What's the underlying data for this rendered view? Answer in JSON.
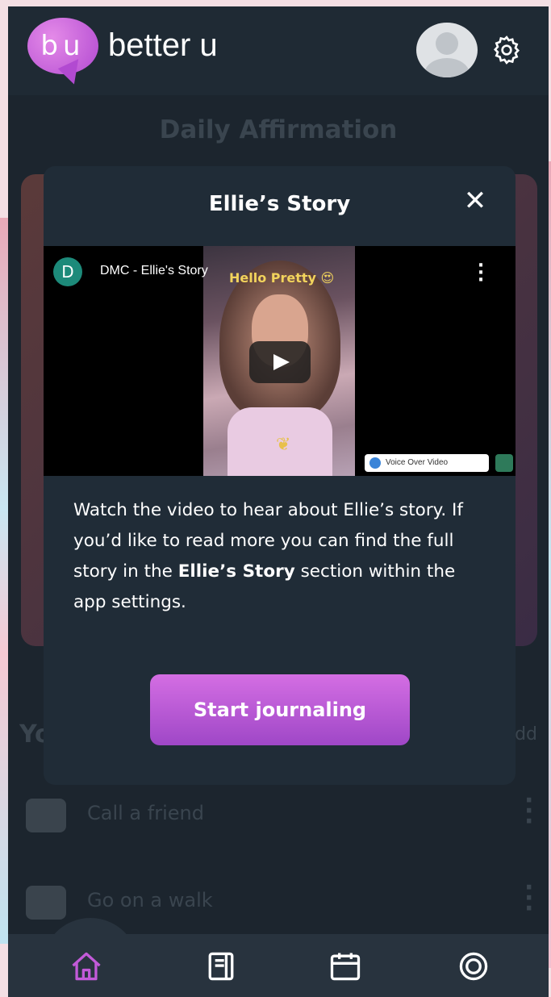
{
  "header": {
    "logo_text": "bu",
    "brand_name": "better u"
  },
  "background": {
    "page_title": "Daily Affirmation",
    "section_title": "Yo",
    "add_label": "Add",
    "todos": [
      {
        "label": "Call a friend"
      },
      {
        "label": "Go on a walk"
      }
    ]
  },
  "modal": {
    "title": "Ellie’s Story",
    "video": {
      "channel_initial": "D",
      "title": "DMC - Ellie's Story",
      "overlay_text": "Hello Pretty 😍",
      "voice_over_label": "Voice Over Video"
    },
    "description_part1": "Watch the video to hear about Ellie’s story. If you’d like to read more you can find the full story in the ",
    "description_bold": "Ellie’s Story",
    "description_part2": " section within the app settings.",
    "button_label": "Start journaling"
  },
  "nav": {
    "items": [
      {
        "icon": "home-icon",
        "active": true
      },
      {
        "icon": "journal-icon",
        "active": false
      },
      {
        "icon": "calendar-icon",
        "active": false
      },
      {
        "icon": "lifebuoy-icon",
        "active": false
      }
    ]
  },
  "colors": {
    "accent": "#c25ad8",
    "background": "#1c252e",
    "modal": "#202c37",
    "nav_active": "#c25ad8"
  }
}
